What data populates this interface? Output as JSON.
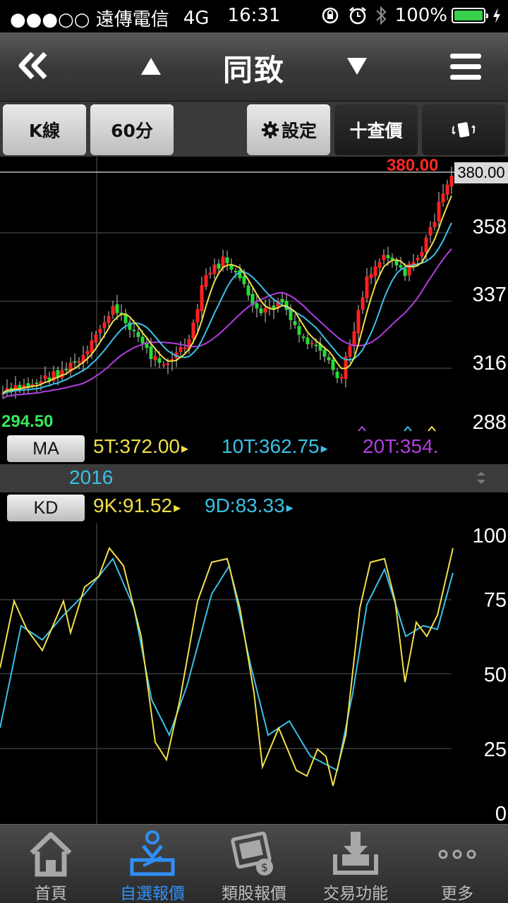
{
  "status": {
    "carrier": "●●●○○ 遠傳電信",
    "network": "4G",
    "time": "16:31",
    "battery": "100%"
  },
  "nav": {
    "title": "同致"
  },
  "toolbar": {
    "kline": "K線",
    "interval": "60分",
    "settings": "設定",
    "quote": "十查價"
  },
  "price_chart": {
    "current_price": "380.00",
    "high_label": "380.00",
    "low_label": "294.50",
    "axis_labels": [
      "358",
      "337",
      "316",
      "288"
    ],
    "ma_button": "MA",
    "ma_legend": [
      {
        "text": "5T:372.00",
        "color": "#f0e04a"
      },
      {
        "text": "10T:362.75",
        "color": "#3cc0e6"
      },
      {
        "text": "20T:354.",
        "color": "#b23ee0"
      }
    ]
  },
  "year_label": "2016",
  "kd": {
    "button": "KD",
    "legend": [
      {
        "text": "9K:91.52",
        "color": "#f0e04a"
      },
      {
        "text": "9D:83.33",
        "color": "#3cc0e6"
      }
    ],
    "axis_labels": [
      "100",
      "75",
      "50",
      "25",
      "0"
    ]
  },
  "tabs": [
    {
      "label": "首頁",
      "icon": "home-icon"
    },
    {
      "label": "自選報價",
      "icon": "watchlist-icon"
    },
    {
      "label": "類股報價",
      "icon": "film-money-icon"
    },
    {
      "label": "交易功能",
      "icon": "download-tray-icon"
    },
    {
      "label": "更多",
      "icon": "more-icon"
    }
  ],
  "colors": {
    "up": "#ff2020",
    "down": "#22dd33",
    "ma5": "#f0e04a",
    "ma10": "#3cc0e6",
    "ma20": "#b23ee0",
    "active_tab": "#2f8ff7"
  }
}
